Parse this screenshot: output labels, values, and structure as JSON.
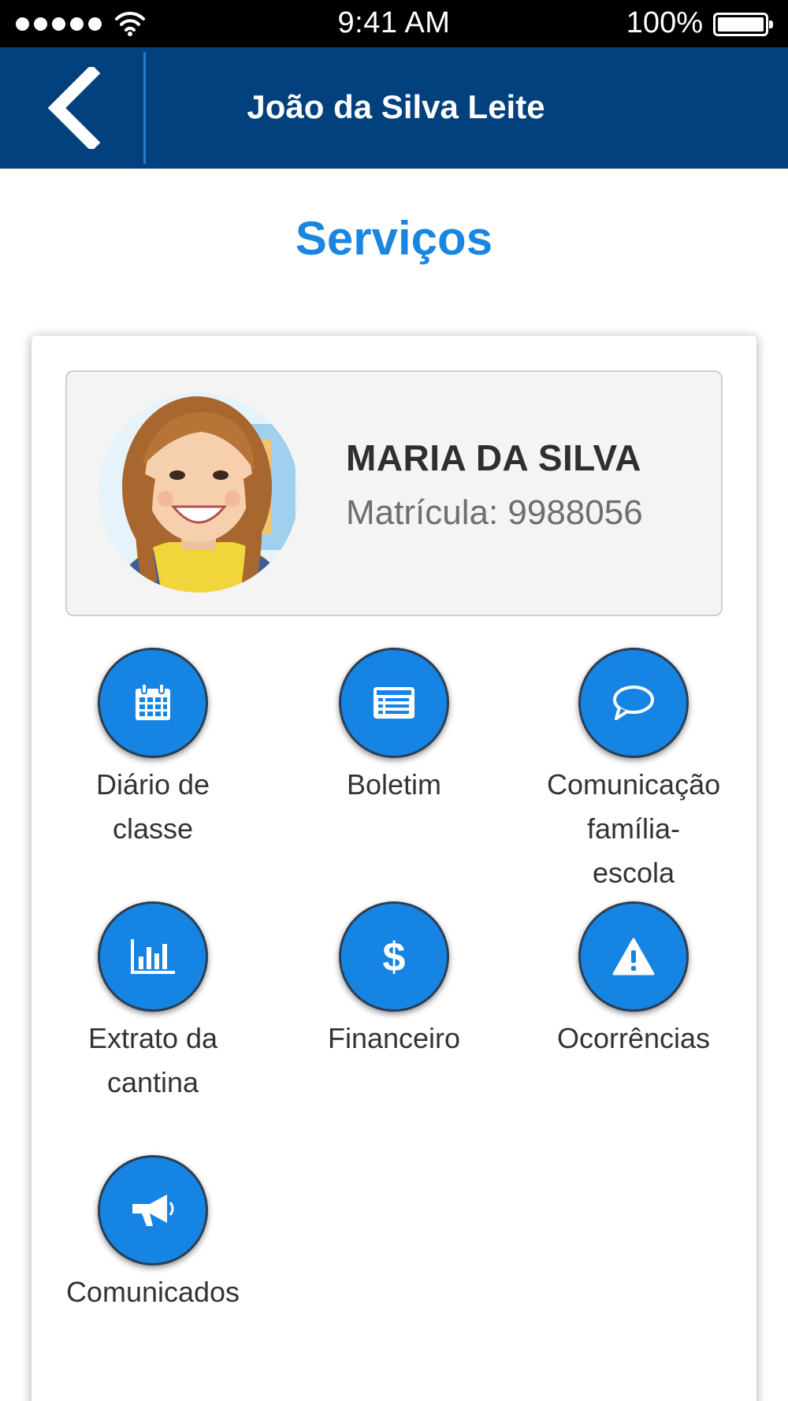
{
  "status_bar": {
    "time": "9:41 AM",
    "battery": "100%"
  },
  "header": {
    "title": "João da Silva Leite",
    "back_icon": "chevron-left-icon"
  },
  "page": {
    "title": "Serviços"
  },
  "student": {
    "name": "MARIA DA SILVA",
    "matricula": "Matrícula: 9988056"
  },
  "services": [
    {
      "label": "Diário de classe",
      "icon": "calendar-icon"
    },
    {
      "label": "Boletim",
      "icon": "report-card-icon"
    },
    {
      "label": "Comunicação família-escola",
      "icon": "chat-bubble-icon"
    },
    {
      "label": "Extrato da cantina",
      "icon": "bar-chart-icon"
    },
    {
      "label": "Financeiro",
      "icon": "dollar-icon"
    },
    {
      "label": "Ocorrências",
      "icon": "warning-icon"
    },
    {
      "label": "Comunicados",
      "icon": "megaphone-icon"
    }
  ],
  "colors": {
    "header_bg": "#03407e",
    "accent": "#1684e3",
    "title_blue": "#1a86e0"
  }
}
